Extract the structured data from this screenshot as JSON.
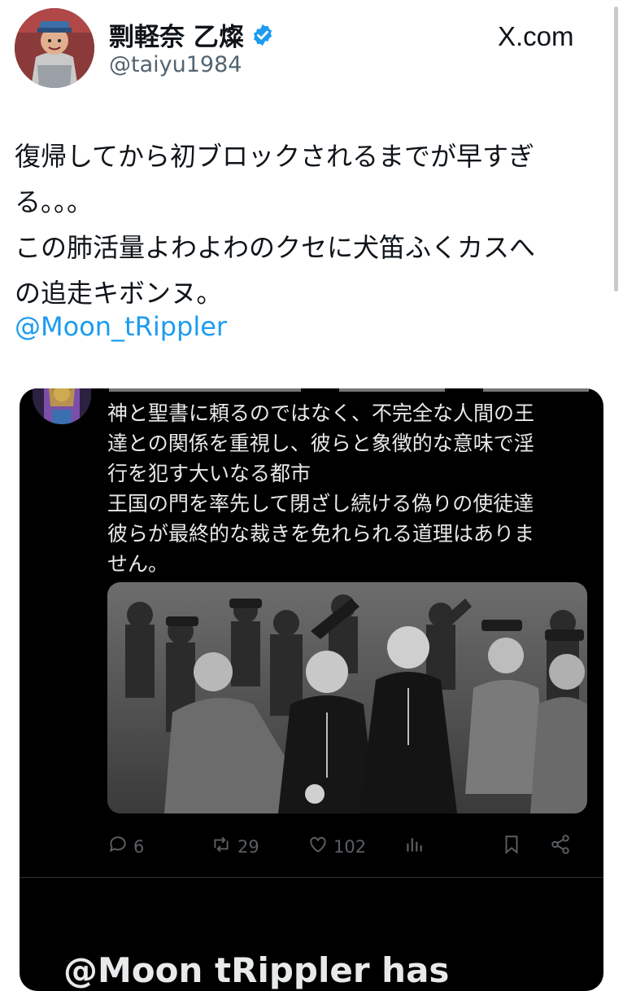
{
  "tweet": {
    "display_name": "剽軽奈 乙燦",
    "handle": "@taiyu1984",
    "source_site": "X.com",
    "text_lines": [
      "復帰してから初ブロックされるまでが早すぎ",
      "る。。。",
      "この肺活量よわよわのクセに犬笛ふくカスへ",
      "の追走キボンヌ。"
    ],
    "mention": "@Moon_tRippler"
  },
  "embedded_post": {
    "text_lines": [
      "神と聖書に頼るのではなく、不完全な人間の王",
      "達との関係を重視し、彼らと象徴的な意味で淫",
      "行を犯す大いなる都市",
      "王国の門を率先して閉ざし続ける偽りの使徒達",
      "彼らが最終的な裁きを免れられる道理はありま",
      "せん。"
    ],
    "image_description_icon": "photo",
    "actions": {
      "replies": "6",
      "reposts": "29",
      "likes": "102"
    },
    "notice_text": "@Moon tRippler has"
  },
  "icons": {
    "verified": "verified-badge-icon",
    "reply": "reply-icon",
    "repost": "repost-icon",
    "like": "like-icon",
    "views": "views-icon",
    "bookmark": "bookmark-icon",
    "share": "share-icon"
  },
  "colors": {
    "link": "#1d9bf0",
    "verified": "#1d9bf0",
    "text": "#0f1419",
    "muted": "#536471",
    "dark_bg": "#000000"
  }
}
